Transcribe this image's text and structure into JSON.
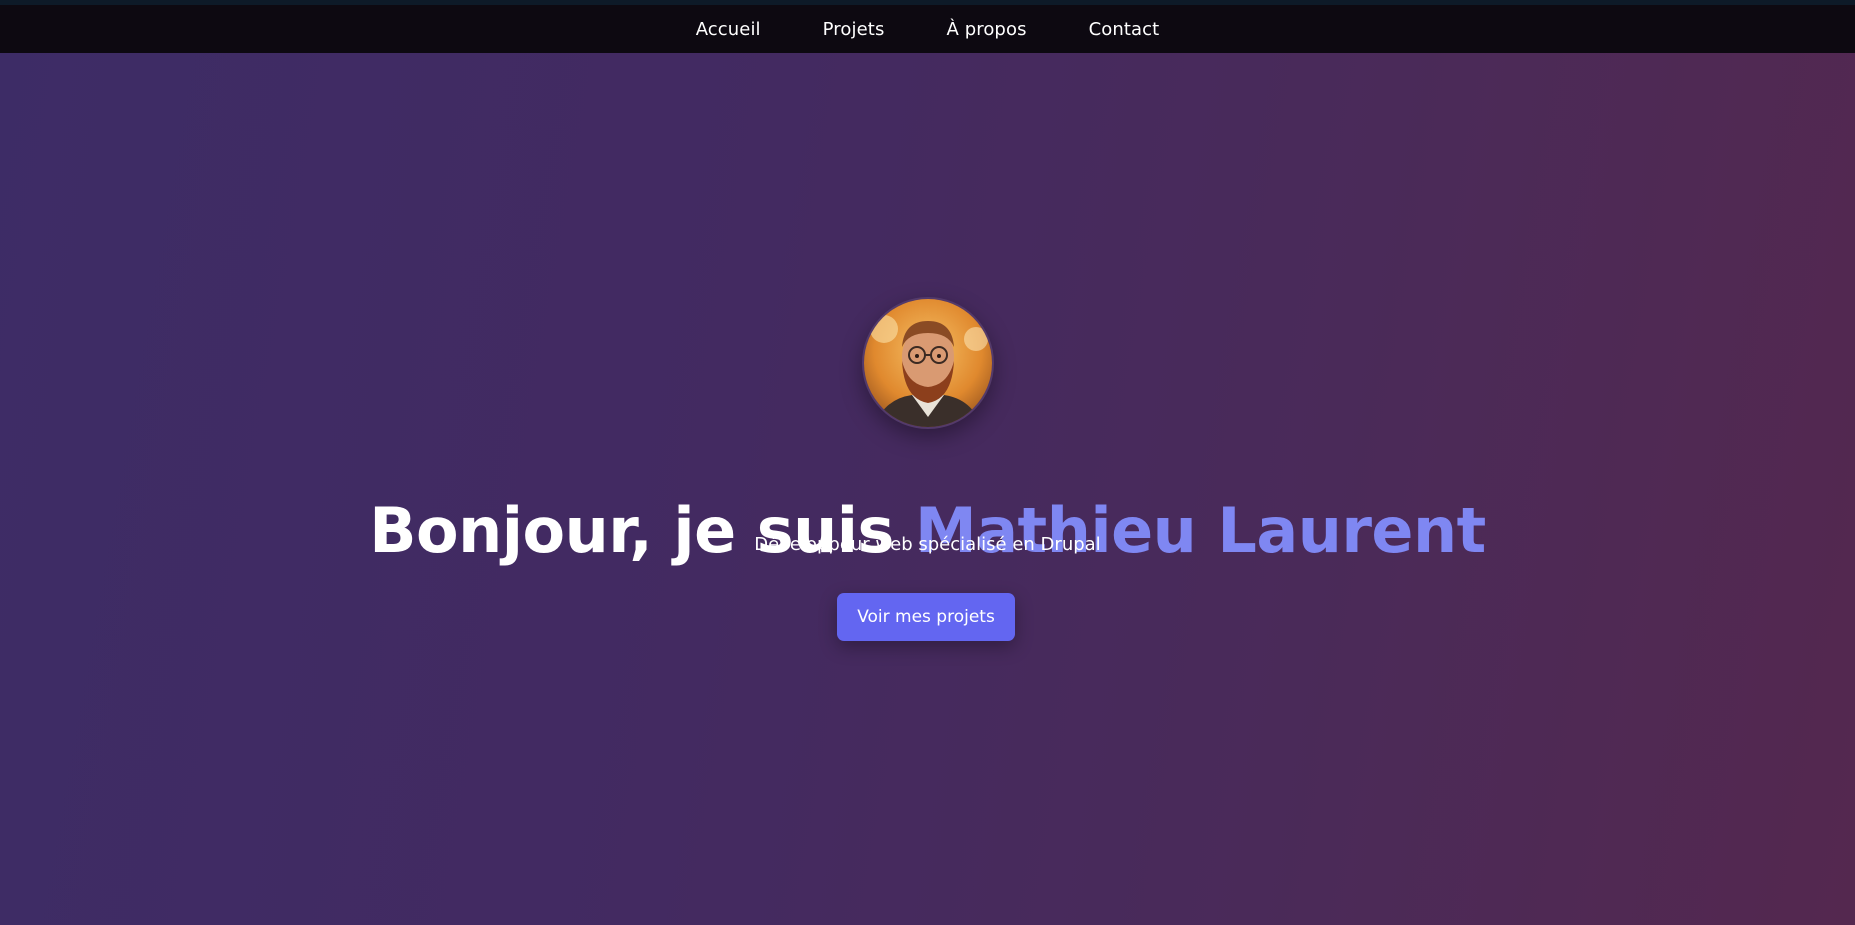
{
  "nav": {
    "items": [
      {
        "label": "Accueil"
      },
      {
        "label": "Projets"
      },
      {
        "label": "À propos"
      },
      {
        "label": "Contact"
      }
    ]
  },
  "hero": {
    "greeting": "Bonjour, je suis",
    "name": "Mathieu Laurent",
    "subtitle": "Développeur web spécialisé en Drupal",
    "cta_label": "Voir mes projets",
    "avatar_icon": "profile-photo"
  },
  "colors": {
    "accent": "#6366f1",
    "name_highlight": "#7f87f2",
    "nav_bg": "#0d0911"
  }
}
